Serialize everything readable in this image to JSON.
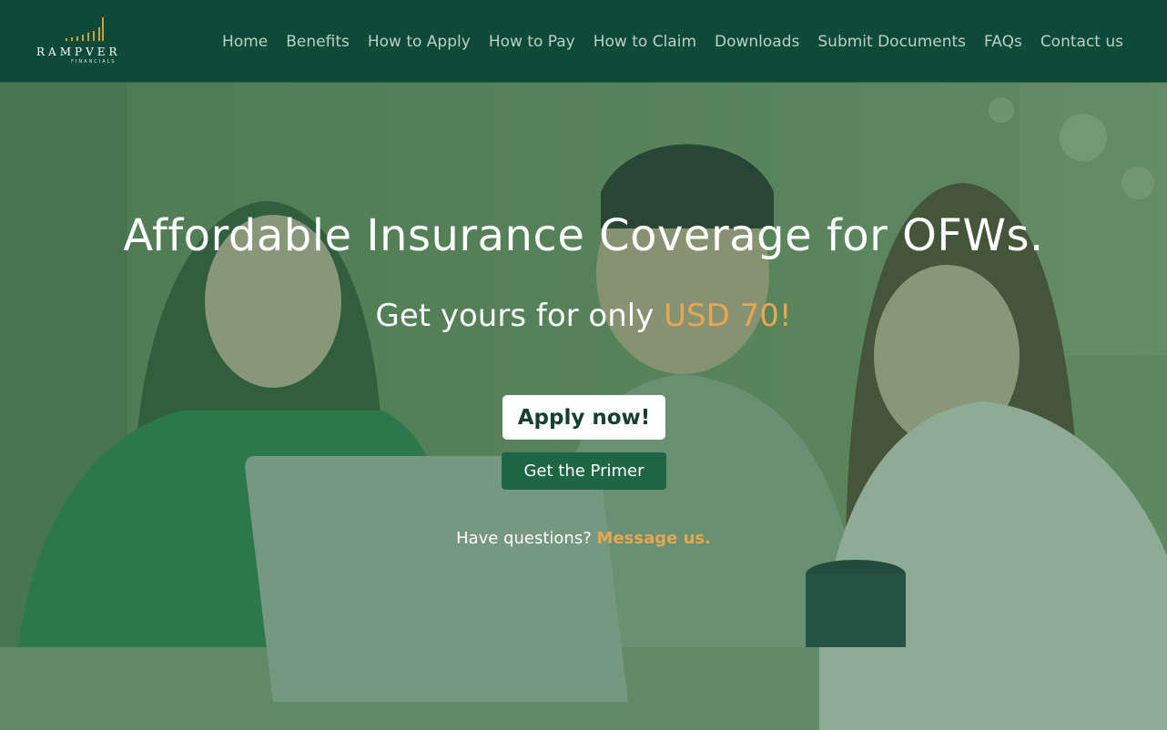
{
  "brand": {
    "name": "RAMPVER",
    "subtitle": "FINANCIALS",
    "accent": "#c9a23f"
  },
  "nav": {
    "items": [
      "Home",
      "Benefits",
      "How to Apply",
      "How to Pay",
      "How to Claim",
      "Downloads",
      "Submit Documents",
      "FAQs",
      "Contact us"
    ]
  },
  "hero": {
    "headline": "Affordable Insurance Coverage for OFWs.",
    "sub_prefix": "Get yours for only",
    "price": "USD 70!",
    "apply_label": "Apply now!",
    "primer_label": "Get the Primer",
    "question_text": "Have questions?",
    "message_link": "Message us."
  },
  "colors": {
    "nav_bg": "#0f4a39",
    "highlight": "#e7a751",
    "primer_bg": "#1e6543"
  }
}
